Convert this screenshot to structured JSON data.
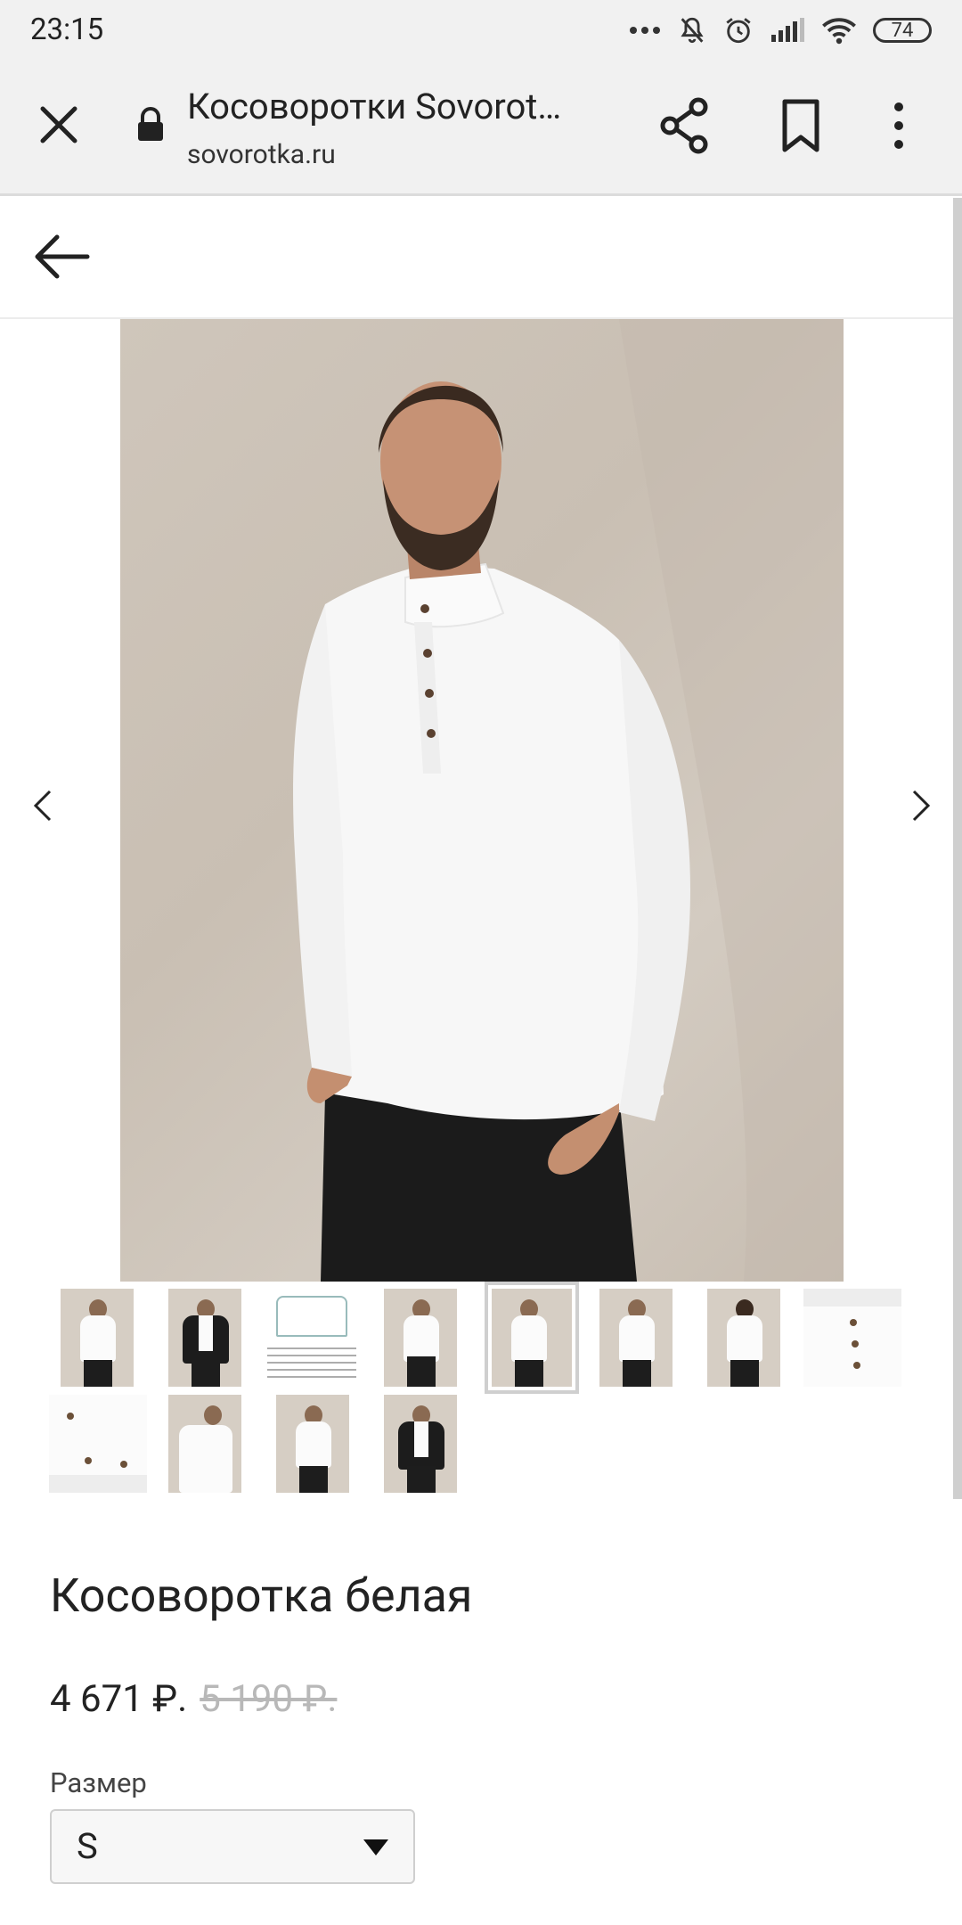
{
  "status_bar": {
    "time": "23:15",
    "battery": "74"
  },
  "browser": {
    "tab_title": "Косоворотки Sovorot…",
    "url": "sovorotka.ru"
  },
  "gallery": {
    "thumbnail_count": 12,
    "selected_thumbnail_index": 4
  },
  "product": {
    "title": "Косоворотка белая",
    "price_current": "4 671 ₽.",
    "price_old": "5 190 ₽.",
    "size_label": "Размер",
    "size_selected": "S"
  }
}
